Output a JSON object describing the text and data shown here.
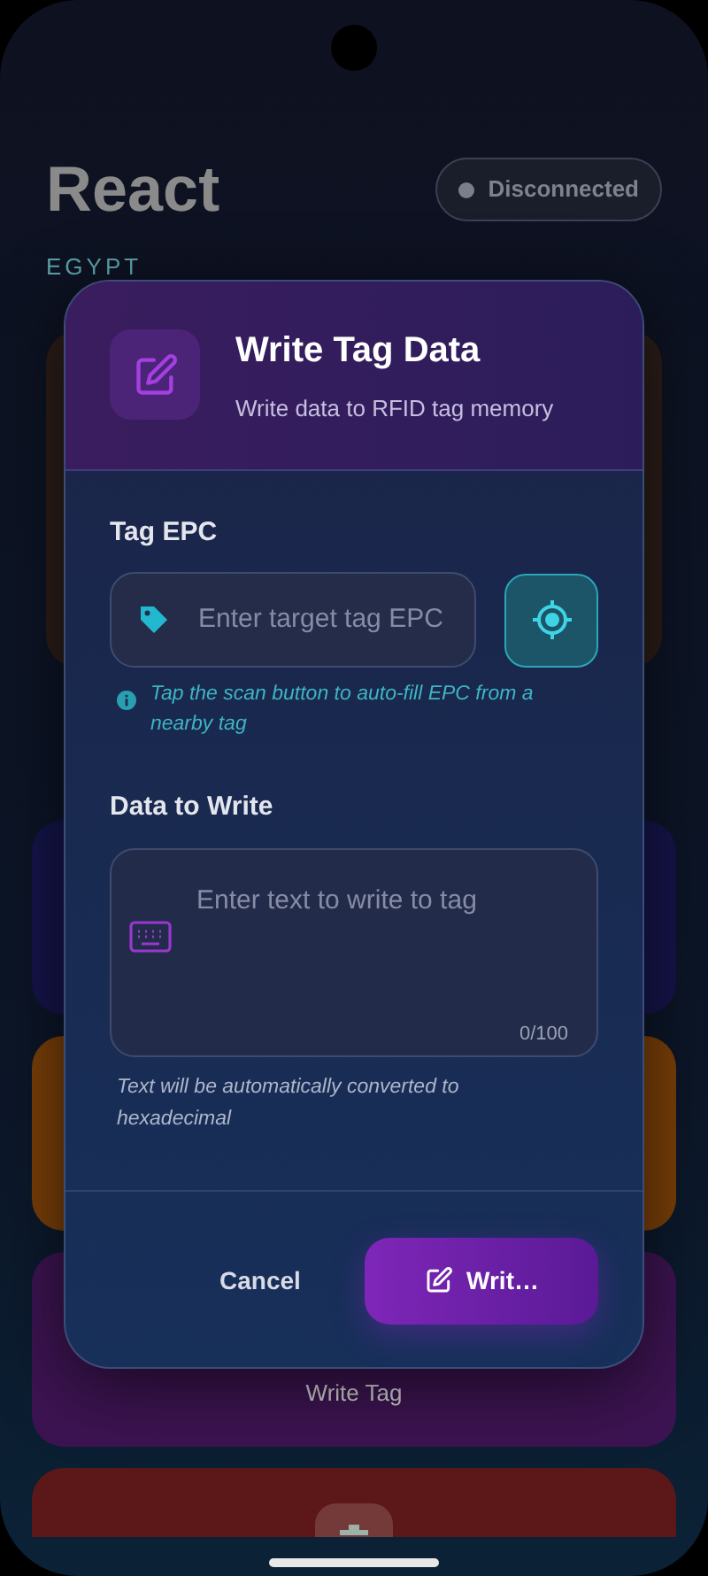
{
  "app": {
    "title": "React",
    "subtitle": "EGYPT",
    "connection": {
      "label": "Disconnected",
      "connected": false
    },
    "top_card": {
      "color": "#2b1d18"
    },
    "cards": [
      {
        "kind": "blank",
        "color": "#15144a"
      },
      {
        "kind": "blank",
        "color": "#7a3f08"
      },
      {
        "kind": "labeled",
        "color": "#3d1452",
        "label": "Write Tag"
      },
      {
        "kind": "icon",
        "color": "#5c1818"
      }
    ]
  },
  "dialog": {
    "title": "Write Tag Data",
    "subtitle": "Write data to RFID tag memory",
    "fields": [
      {
        "kind": "input",
        "label": "Tag EPC",
        "placeholder": "Enter target tag EPC",
        "hint": "Tap the scan button to auto-fill EPC from a nearby tag"
      },
      {
        "kind": "textarea",
        "label": "Data to Write",
        "placeholder": "Enter text to write to tag",
        "counter": "0/100",
        "hint": "Text will be automatically converted to hexadecimal"
      }
    ],
    "buttons": [
      {
        "kind": "text",
        "label": "Cancel"
      },
      {
        "kind": "primary",
        "label": "Writ…"
      }
    ]
  }
}
